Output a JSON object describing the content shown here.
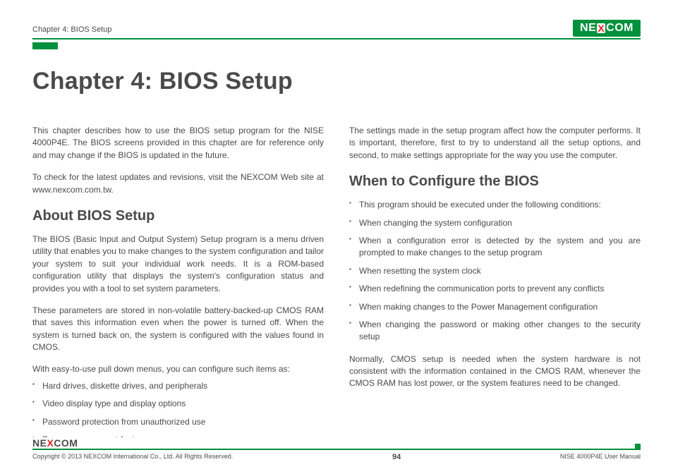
{
  "header": {
    "chapter_label": "Chapter 4: BIOS Setup",
    "logo_text_left": "NE",
    "logo_text_x": "X",
    "logo_text_right": "COM"
  },
  "title": "Chapter 4: BIOS Setup",
  "left_column": {
    "intro_p1": "This chapter describes how to use the BIOS setup program for the NISE 4000P4E. The BIOS screens provided in this chapter are for reference only and may change if the BIOS is updated in the future.",
    "intro_p2": "To check for the latest updates and revisions, visit the NEXCOM Web site at www.nexcom.com.tw.",
    "section_heading": "About BIOS Setup",
    "about_p1": "The BIOS (Basic Input and Output System) Setup program is a menu driven utility that enables you to make changes to the system configuration and tailor your system to suit your individual work needs. It is a ROM-based configuration utility that displays the system's configuration status and provides you with a tool to set system parameters.",
    "about_p2": "These parameters are stored in non-volatile battery-backed-up CMOS RAM that saves this information even when the power is turned off. When the system is turned back on, the system is configured with the values found in CMOS.",
    "about_p3": "With easy-to-use pull down menus, you can configure such items as:",
    "about_bullets": [
      "Hard drives, diskette drives, and peripherals",
      "Video display type and display options",
      "Password protection from unauthorized use",
      "Power management features"
    ]
  },
  "right_column": {
    "intro_p1": "The settings made in the setup program affect how the computer performs. It is important, therefore, first to try to understand all the setup options, and second, to make settings appropriate for the way you use the computer.",
    "section_heading": "When to Configure the BIOS",
    "when_bullets": [
      "This program should be executed under the following conditions:",
      "When changing the system configuration",
      "When a configuration error is detected by the system and you are prompted to make changes to the setup program",
      "When resetting the system clock",
      "When redefining the communication ports to prevent any conflicts",
      "When making changes to the Power Management configuration",
      "When changing the password or making other changes to the security setup"
    ],
    "when_p_after": "Normally, CMOS setup is needed when the system hardware is not consistent with the information contained in the CMOS RAM, whenever the CMOS RAM has lost power, or the system features need to be changed."
  },
  "footer": {
    "logo_text_left": "NE",
    "logo_text_x": "X",
    "logo_text_right": "COM",
    "copyright": "Copyright © 2013 NEXCOM International Co., Ltd. All Rights Reserved.",
    "page_number": "94",
    "doc_label": "NISE 4000P4E User Manual"
  }
}
